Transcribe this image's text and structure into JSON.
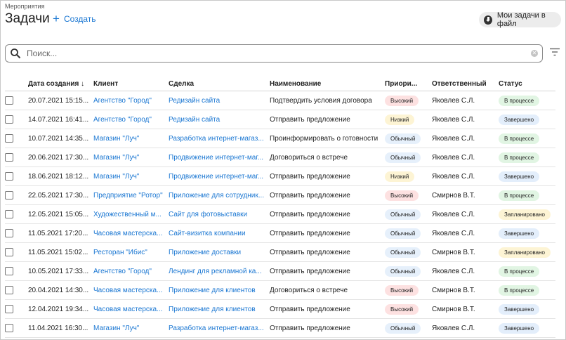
{
  "header": {
    "breadcrumb": "Мероприятия",
    "title": "Задачи",
    "create_label": "Создать",
    "export_label": "Мои задачи в файл"
  },
  "search": {
    "placeholder": "Поиск..."
  },
  "icons": {
    "create": "plus-icon",
    "export": "download-icon",
    "search": "search-icon",
    "clear": "clear-icon",
    "filter": "filter-icon",
    "sort": "arrow-down-icon"
  },
  "colors": {
    "accent": "#1976d2",
    "priority_high": "#fde1e1",
    "priority_low": "#fdf4d4",
    "priority_normal": "#e6f0fb",
    "status_progress": "#e1f5e3",
    "status_done": "#e3eefb",
    "status_planned": "#fdf4d4"
  },
  "table": {
    "columns": [
      "Дата создания ↓",
      "Клиент",
      "Сделка",
      "Наименование",
      "Приори...",
      "Ответственный",
      "Статус"
    ],
    "rows": [
      {
        "date": "20.07.2021 15:15...",
        "client": "Агентство \"Город\"",
        "deal": "Редизайн сайта",
        "name": "Подтвердить условия договора",
        "priority": "Высокий",
        "owner": "Яковлев С.Л.",
        "status": "В процессе"
      },
      {
        "date": "14.07.2021 16:41...",
        "client": "Агентство \"Город\"",
        "deal": "Редизайн сайта",
        "name": "Отправить предложение",
        "priority": "Низкий",
        "owner": "Яковлев С.Л.",
        "status": "Завершено"
      },
      {
        "date": "10.07.2021 14:35...",
        "client": "Магазин \"Луч\"",
        "deal": "Разработка интернет-магаз...",
        "name": "Проинформировать о готовности",
        "priority": "Обычный",
        "owner": "Яковлев С.Л.",
        "status": "В процессе"
      },
      {
        "date": "20.06.2021 17:30...",
        "client": "Магазин \"Луч\"",
        "deal": "Продвижение интернет-маг...",
        "name": "Договориться о встрече",
        "priority": "Обычный",
        "owner": "Яковлев С.Л.",
        "status": "В процессе"
      },
      {
        "date": "18.06.2021 18:12...",
        "client": "Магазин \"Луч\"",
        "deal": "Продвижение интернет-маг...",
        "name": "Отправить предложение",
        "priority": "Низкий",
        "owner": "Яковлев С.Л.",
        "status": "Завершено"
      },
      {
        "date": "22.05.2021 17:30...",
        "client": "Предприятие \"Ротор\"",
        "deal": "Приложение для сотрудник...",
        "name": "Отправить предложение",
        "priority": "Высокий",
        "owner": "Смирнов В.Т.",
        "status": "В процессе"
      },
      {
        "date": "12.05.2021 15:05...",
        "client": "Художественный м...",
        "deal": "Сайт для фотовыставки",
        "name": "Отправить предложение",
        "priority": "Обычный",
        "owner": "Яковлев С.Л.",
        "status": "Запланировано"
      },
      {
        "date": "11.05.2021 17:20...",
        "client": "Часовая мастерска...",
        "deal": "Сайт-визитка компании",
        "name": "Отправить предложение",
        "priority": "Обычный",
        "owner": "Яковлев С.Л.",
        "status": "Завершено"
      },
      {
        "date": "11.05.2021 15:02...",
        "client": "Ресторан \"Ибис\"",
        "deal": "Приложение доставки",
        "name": "Отправить предложение",
        "priority": "Обычный",
        "owner": "Смирнов В.Т.",
        "status": "Запланировано"
      },
      {
        "date": "10.05.2021 17:33...",
        "client": "Агентство \"Город\"",
        "deal": "Лендинг для рекламной ка...",
        "name": "Отправить предложение",
        "priority": "Обычный",
        "owner": "Яковлев С.Л.",
        "status": "В процессе"
      },
      {
        "date": "20.04.2021 14:30...",
        "client": "Часовая мастерска...",
        "deal": "Приложение для клиентов",
        "name": "Договориться о встрече",
        "priority": "Высокий",
        "owner": "Смирнов В.Т.",
        "status": "В процессе"
      },
      {
        "date": "12.04.2021 19:34...",
        "client": "Часовая мастерска...",
        "deal": "Приложение для клиентов",
        "name": "Отправить предложение",
        "priority": "Высокий",
        "owner": "Смирнов В.Т.",
        "status": "Завершено"
      },
      {
        "date": "11.04.2021 16:30...",
        "client": "Магазин \"Луч\"",
        "deal": "Разработка интернет-магаз...",
        "name": "Отправить предложение",
        "priority": "Обычный",
        "owner": "Яковлев С.Л.",
        "status": "Завершено"
      }
    ]
  }
}
